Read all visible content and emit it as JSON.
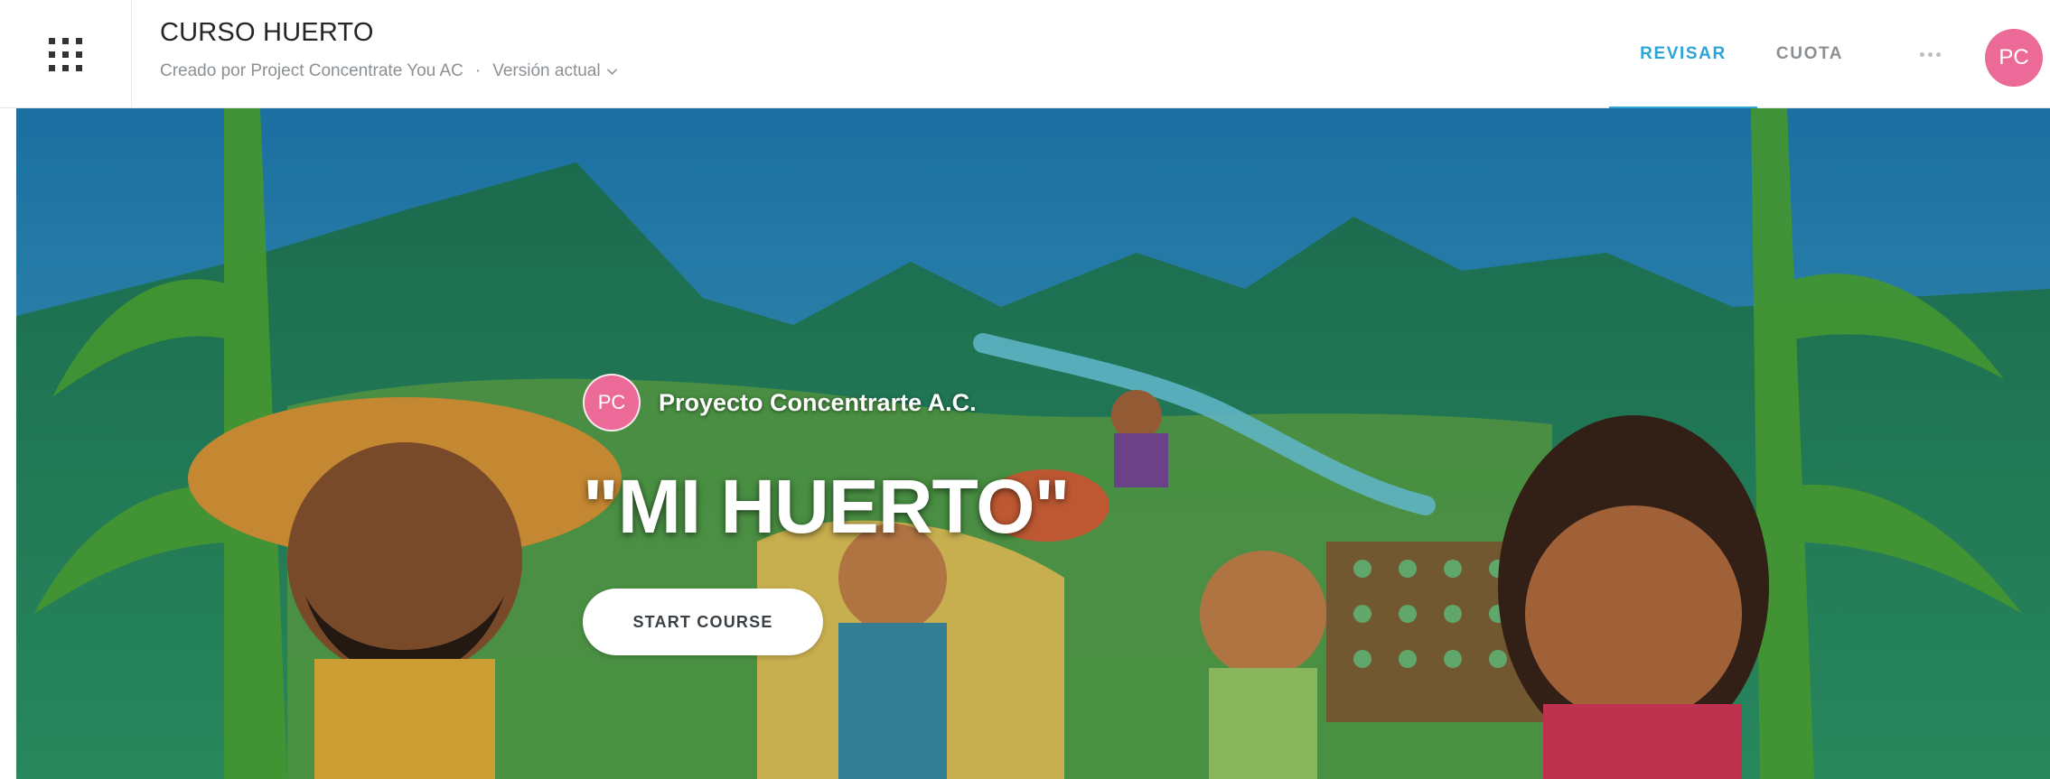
{
  "header": {
    "menu_icon": "grid-dots-icon",
    "course_title": "CURSO HUERTO",
    "created_by": "Creado por Project Concentrate You AC",
    "separator": "·",
    "version_label": "Versión actual",
    "version_icon": "chevron-down-icon",
    "tabs": [
      {
        "label": "REVISAR",
        "active": true
      },
      {
        "label": "CUOTA",
        "active": false
      }
    ],
    "more_icon": "more-dots-icon",
    "avatar_initials": "PC"
  },
  "hero": {
    "author_initials": "PC",
    "author_name": "Proyecto Concentrarte A.C.",
    "title": "\"MI HUERTO\"",
    "start_button": "START COURSE"
  },
  "colors": {
    "accent": "#2ba4d8",
    "avatar": "#ec6a98",
    "title_text": "#222629",
    "muted_text": "#8b9094"
  }
}
